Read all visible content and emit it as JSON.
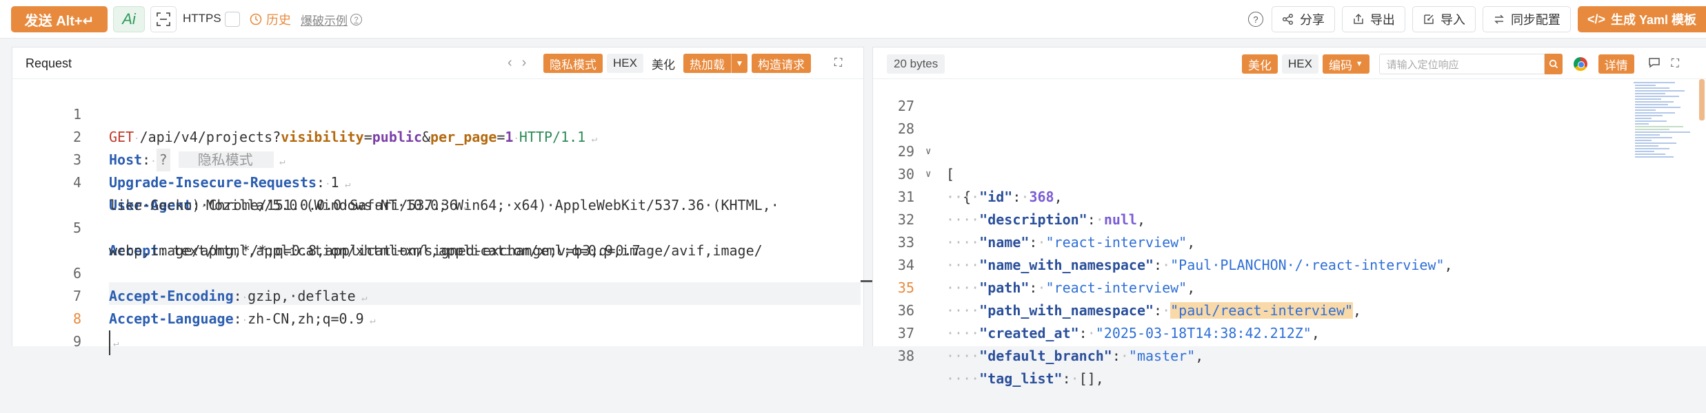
{
  "toolbar": {
    "send_label": "发送 Alt+↵",
    "ai_label": "Ai",
    "https_label": "HTTPS",
    "history_label": "历史",
    "example_label": "爆破示例",
    "share_label": "分享",
    "export_label": "导出",
    "import_label": "导入",
    "sync_label": "同步配置",
    "generate_label": "生成 Yaml 模板"
  },
  "request_panel": {
    "title": "Request",
    "privacy_mode": "隐私模式",
    "hex": "HEX",
    "beautify": "美化",
    "hot_load": "热加载",
    "build_request": "构造请求"
  },
  "request_lines": [
    {
      "num": "1",
      "method": "GET",
      "path": "/api/v4/projects?",
      "p1k": "visibility",
      "p1v": "public",
      "p2k": "per_page",
      "p2v": "1",
      "proto": "HTTP/1.1"
    },
    {
      "num": "2",
      "key": "Host",
      "q": "?",
      "privacy": "隐私模式"
    },
    {
      "num": "3",
      "key": "Upgrade-Insecure-Requests",
      "value": "1"
    },
    {
      "num": "4",
      "key": "User-Agent",
      "value": "Mozilla/5.0·(Windows·NT·10.0;·Win64;·x64)·AppleWebKit/537.36·(KHTML,·",
      "value2": "like·Gecko)·Chrome/151.0.0.0·Safari/537.36"
    },
    {
      "num": "5",
      "key": "Accept",
      "value": "text/html,application/xhtml+xml,application/xml;q=0.9,image/avif,image/",
      "value2": "webp,image/apng,*/*;q=0.8,application/signed-exchange;v=b3;q=0.7"
    },
    {
      "num": "6",
      "key": "Accept-Encoding",
      "value": "gzip,·deflate"
    },
    {
      "num": "7",
      "key": "Accept-Language",
      "value": "zh-CN,zh;q=0.9"
    },
    {
      "num": "8"
    },
    {
      "num": "9"
    }
  ],
  "response_panel": {
    "bytes": "20 bytes",
    "beautify": "美化",
    "hex": "HEX",
    "encoding": "编码",
    "locate_placeholder": "请输入定位响应",
    "details": "详情"
  },
  "response_lines": [
    {
      "num": "27"
    },
    {
      "num": "28",
      "text": "["
    },
    {
      "num": "29",
      "text": "{"
    },
    {
      "num": "30",
      "key": "\"id\"",
      "num_val": "368"
    },
    {
      "num": "31",
      "key": "\"description\"",
      "null_val": "null"
    },
    {
      "num": "32",
      "key": "\"name\"",
      "str_val": "\"react-interview\""
    },
    {
      "num": "33",
      "key": "\"name_with_namespace\"",
      "str_val": "\"Paul·PLANCHON·/·react-interview\""
    },
    {
      "num": "34",
      "key": "\"path\"",
      "str_val": "\"react-interview\""
    },
    {
      "num": "35",
      "key": "\"path_with_namespace\"",
      "str_val": "\"paul/react-interview\""
    },
    {
      "num": "36",
      "key": "\"created_at\"",
      "str_val": "\"2025-03-18T14:38:42.212Z\""
    },
    {
      "num": "37",
      "key": "\"default_branch\"",
      "str_val": "\"master\""
    },
    {
      "num": "38",
      "key": "\"tag_list\"",
      "text_val": "[],"
    }
  ],
  "colors": {
    "accent": "#e88a3d"
  }
}
